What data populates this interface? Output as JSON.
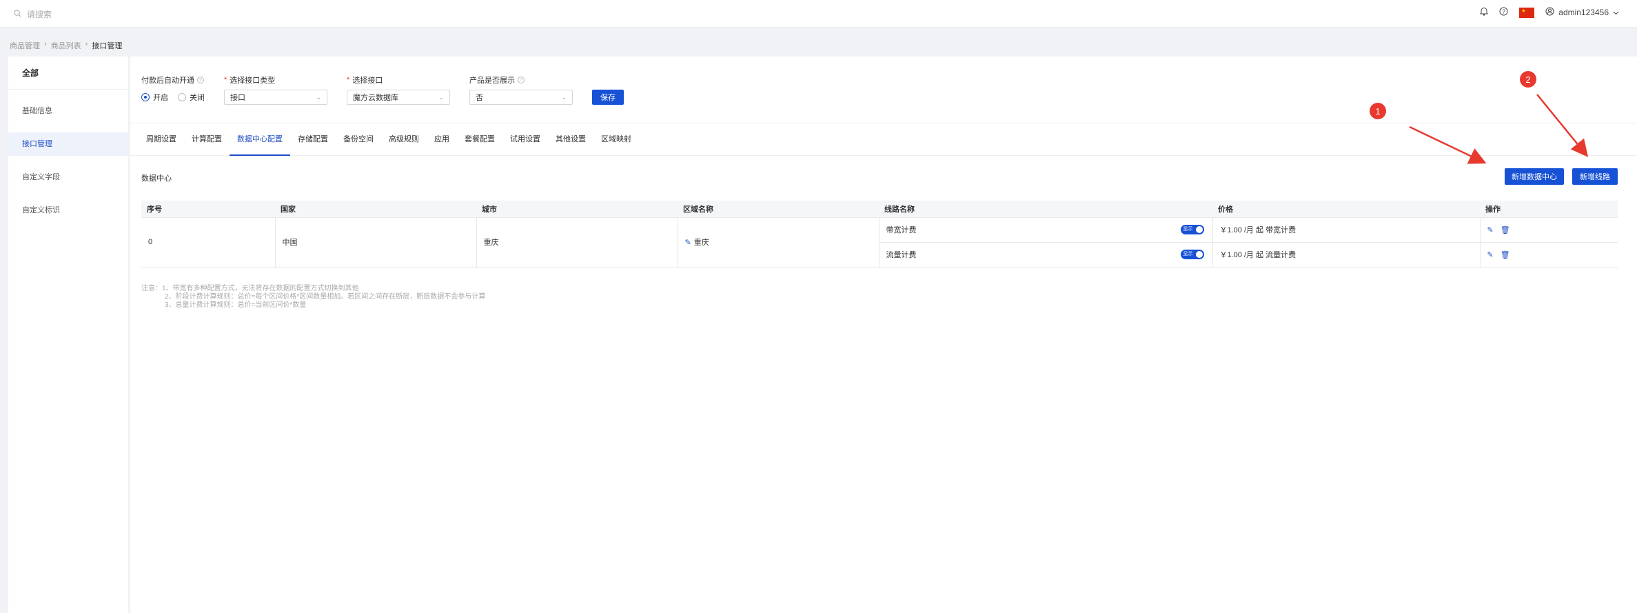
{
  "topbar": {
    "search_placeholder": "请搜索",
    "username": "admin123456",
    "icons": [
      "search-icon",
      "bell-icon",
      "help-icon",
      "china-flag-icon",
      "user-icon",
      "chevron-down-icon"
    ]
  },
  "breadcrumb": [
    "商品管理",
    "商品列表",
    "接口管理"
  ],
  "sidebar": {
    "all_label": "全部",
    "items": [
      {
        "label": "基础信息",
        "active": false
      },
      {
        "label": "接口管理",
        "active": true
      },
      {
        "label": "自定义字段",
        "active": false
      },
      {
        "label": "自定义标识",
        "active": false
      }
    ]
  },
  "form": {
    "auto_open": {
      "label": "付款后自动开通",
      "options": [
        "开启",
        "关闭"
      ],
      "selected": "开启"
    },
    "interface_type": {
      "label": "选择接口类型",
      "value": "接口"
    },
    "interface": {
      "label": "选择接口",
      "value": "魔方云数据库"
    },
    "product_display": {
      "label": "产品是否展示",
      "value": "否"
    },
    "save_label": "保存"
  },
  "tabs": [
    {
      "label": "周期设置",
      "active": false
    },
    {
      "label": "计算配置",
      "active": false
    },
    {
      "label": "数据中心配置",
      "active": true
    },
    {
      "label": "存储配置",
      "active": false
    },
    {
      "label": "备份空间",
      "active": false
    },
    {
      "label": "高级规则",
      "active": false
    },
    {
      "label": "应用",
      "active": false
    },
    {
      "label": "套餐配置",
      "active": false
    },
    {
      "label": "试用设置",
      "active": false
    },
    {
      "label": "其他设置",
      "active": false
    },
    {
      "label": "区域映射",
      "active": false
    }
  ],
  "data_center": {
    "section_title": "数据中心",
    "add_dc_label": "新增数据中心",
    "add_line_label": "新增线路",
    "columns": [
      "序号",
      "国家",
      "城市",
      "区域名称",
      "线路名称",
      "价格",
      "操作"
    ],
    "row": {
      "index": "0",
      "country": "中国",
      "city": "重庆",
      "region": "重庆",
      "lines": [
        {
          "name": "带宽计费",
          "toggle": "显示",
          "price": "￥1.00 /月 起  带宽计费"
        },
        {
          "name": "流量计费",
          "toggle": "显示",
          "price": "￥1.00 /月 起  流量计费"
        }
      ]
    }
  },
  "notes": {
    "prefix": "注意：",
    "items": [
      "1、带宽有多种配置方式，无法将存在数据的配置方式切换到其他",
      "2、阶段计费计算规则：总价=每个区间价格*区间数量相加。若区间之间存在断层，断层数据不会参与计算",
      "3、总量计费计算规则：总价=当前区间价*数量"
    ]
  },
  "annotations": {
    "marker1": "1",
    "marker2": "2",
    "color": "#e8392f"
  }
}
